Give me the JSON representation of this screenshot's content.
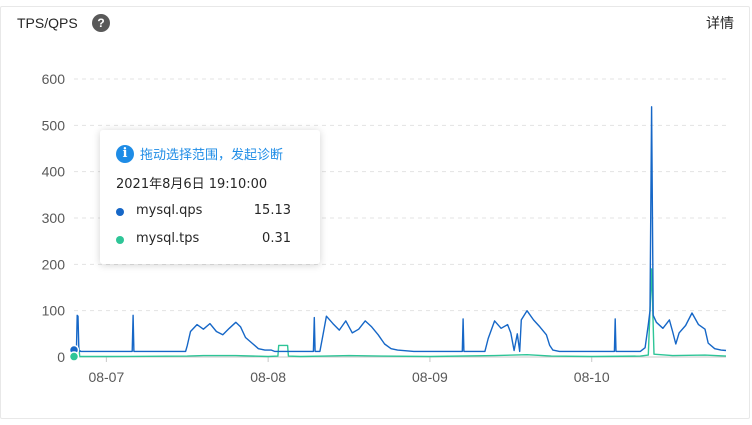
{
  "header": {
    "title": "TPS/QPS",
    "help_glyph": "?",
    "detail_label": "详情"
  },
  "tooltip": {
    "action_label": "拖动选择范围，发起诊断",
    "info_glyph": "i",
    "timestamp": "2021年8月6日 19:10:00",
    "rows": [
      {
        "name": "mysql.qps",
        "value": "15.13",
        "color": "#1667c7"
      },
      {
        "name": "mysql.tps",
        "value": "0.31",
        "color": "#2ec597"
      }
    ]
  },
  "chart_data": {
    "type": "line",
    "title": "TPS/QPS",
    "y_ticks": [
      "600",
      "500",
      "400",
      "300",
      "200",
      "100",
      "0"
    ],
    "ylim": [
      0,
      600
    ],
    "x_ticks": [
      "08-07",
      "08-08",
      "08-09",
      "08-10"
    ],
    "x_range_days": [
      6.8,
      10.83
    ],
    "x_tick_days": [
      7,
      8,
      9,
      10
    ],
    "grid": true,
    "series": [
      {
        "name": "mysql.qps",
        "color": "#1667c7",
        "points": [
          [
            6.8,
            15
          ],
          [
            6.805,
            14
          ],
          [
            6.81,
            12
          ],
          [
            6.815,
            12
          ],
          [
            6.82,
            90
          ],
          [
            6.825,
            88
          ],
          [
            6.83,
            12
          ],
          [
            6.835,
            14
          ],
          [
            6.84,
            12
          ],
          [
            6.85,
            12
          ],
          [
            6.9,
            12
          ],
          [
            7.0,
            12
          ],
          [
            7.05,
            12
          ],
          [
            7.16,
            12
          ],
          [
            7.165,
            90
          ],
          [
            7.17,
            12
          ],
          [
            7.3,
            12
          ],
          [
            7.49,
            12
          ],
          [
            7.5,
            25
          ],
          [
            7.52,
            55
          ],
          [
            7.56,
            70
          ],
          [
            7.6,
            60
          ],
          [
            7.64,
            72
          ],
          [
            7.68,
            55
          ],
          [
            7.72,
            48
          ],
          [
            7.76,
            62
          ],
          [
            7.8,
            75
          ],
          [
            7.83,
            65
          ],
          [
            7.86,
            42
          ],
          [
            7.9,
            30
          ],
          [
            7.94,
            18
          ],
          [
            7.98,
            15
          ],
          [
            8.0,
            15
          ],
          [
            8.02,
            15
          ],
          [
            8.04,
            12
          ],
          [
            8.06,
            12
          ],
          [
            8.28,
            12
          ],
          [
            8.285,
            85
          ],
          [
            8.29,
            12
          ],
          [
            8.32,
            12
          ],
          [
            8.34,
            50
          ],
          [
            8.36,
            88
          ],
          [
            8.4,
            72
          ],
          [
            8.44,
            58
          ],
          [
            8.48,
            78
          ],
          [
            8.52,
            52
          ],
          [
            8.56,
            60
          ],
          [
            8.6,
            78
          ],
          [
            8.64,
            65
          ],
          [
            8.68,
            48
          ],
          [
            8.72,
            28
          ],
          [
            8.76,
            18
          ],
          [
            8.8,
            15
          ],
          [
            8.9,
            12
          ],
          [
            9.0,
            12
          ],
          [
            9.2,
            12
          ],
          [
            9.205,
            82
          ],
          [
            9.21,
            12
          ],
          [
            9.34,
            12
          ],
          [
            9.36,
            40
          ],
          [
            9.4,
            78
          ],
          [
            9.44,
            62
          ],
          [
            9.48,
            70
          ],
          [
            9.5,
            52
          ],
          [
            9.52,
            14
          ],
          [
            9.54,
            50
          ],
          [
            9.555,
            12
          ],
          [
            9.565,
            80
          ],
          [
            9.6,
            100
          ],
          [
            9.64,
            80
          ],
          [
            9.68,
            65
          ],
          [
            9.72,
            48
          ],
          [
            9.74,
            25
          ],
          [
            9.76,
            15
          ],
          [
            9.8,
            12
          ],
          [
            10.0,
            12
          ],
          [
            10.14,
            12
          ],
          [
            10.145,
            82
          ],
          [
            10.15,
            12
          ],
          [
            10.3,
            12
          ],
          [
            10.33,
            20
          ],
          [
            10.35,
            70
          ],
          [
            10.36,
            100
          ],
          [
            10.37,
            540
          ],
          [
            10.38,
            90
          ],
          [
            10.4,
            75
          ],
          [
            10.44,
            62
          ],
          [
            10.48,
            80
          ],
          [
            10.5,
            55
          ],
          [
            10.52,
            28
          ],
          [
            10.54,
            52
          ],
          [
            10.58,
            68
          ],
          [
            10.62,
            95
          ],
          [
            10.66,
            70
          ],
          [
            10.7,
            60
          ],
          [
            10.72,
            30
          ],
          [
            10.76,
            18
          ],
          [
            10.8,
            15
          ],
          [
            10.83,
            14
          ]
        ]
      },
      {
        "name": "mysql.tps",
        "color": "#2ec597",
        "points": [
          [
            6.8,
            1
          ],
          [
            6.81,
            1
          ],
          [
            6.815,
            1
          ],
          [
            6.82,
            20
          ],
          [
            6.83,
            20
          ],
          [
            6.835,
            1
          ],
          [
            7.0,
            1
          ],
          [
            7.5,
            2
          ],
          [
            7.6,
            3
          ],
          [
            7.8,
            3
          ],
          [
            8.0,
            1
          ],
          [
            8.06,
            2
          ],
          [
            8.065,
            25
          ],
          [
            8.12,
            25
          ],
          [
            8.125,
            2
          ],
          [
            8.2,
            1
          ],
          [
            8.35,
            2
          ],
          [
            8.5,
            3
          ],
          [
            8.7,
            2
          ],
          [
            9.0,
            1
          ],
          [
            9.4,
            3
          ],
          [
            9.6,
            5
          ],
          [
            9.75,
            2
          ],
          [
            10.0,
            1
          ],
          [
            10.3,
            2
          ],
          [
            10.35,
            4
          ],
          [
            10.37,
            190
          ],
          [
            10.385,
            6
          ],
          [
            10.5,
            3
          ],
          [
            10.7,
            4
          ],
          [
            10.83,
            2
          ]
        ]
      }
    ]
  }
}
